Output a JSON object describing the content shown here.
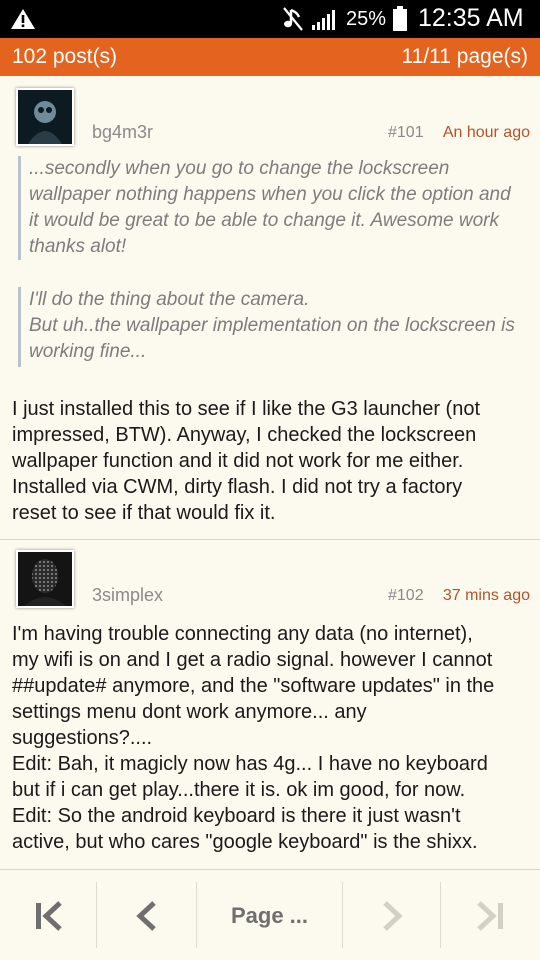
{
  "status_bar": {
    "battery_percent": "25%",
    "time": "12:35 AM",
    "icons": [
      "warning-icon",
      "mute-icon",
      "signal-icon",
      "battery-icon"
    ]
  },
  "header": {
    "posts_count": "102 post(s)",
    "page_info": "11/11 page(s)"
  },
  "posts": [
    {
      "username": "bg4m3r",
      "number": "#101",
      "time": "An hour ago",
      "quotes": [
        [
          "...secondly when you go to change the lockscreen",
          "wallpaper nothing happens when you click the option and",
          "it would be great to be able to change it. Awesome work",
          "thanks alot!"
        ],
        [
          "I'll do the thing about the camera.",
          "But uh..the wallpaper implementation on the lockscreen is",
          "working fine..."
        ]
      ],
      "body": [
        "I just installed this to see if I like the G3 launcher (not",
        "impressed, BTW). Anyway, I checked the lockscreen",
        "wallpaper function and it did not work for me either.",
        "Installed via CWM, dirty flash. I did not try a factory",
        "reset to see if that would fix it."
      ]
    },
    {
      "username": "3simplex",
      "number": "#102",
      "time": "37 mins ago",
      "body": [
        "I'm having trouble connecting any data (no internet),",
        "my wifi is on and I get a radio signal. however I cannot",
        "##update# anymore, and the \"software updates\" in the",
        "settings menu dont work anymore... any",
        "suggestions?....",
        "Edit: Bah, it magicly now has 4g... I have no keyboard",
        "but if i can get play...there it is. ok im good, for now.",
        "Edit: So the android keyboard is there it just wasn't",
        "active, but who cares \"google keyboard\" is the shixx."
      ]
    }
  ],
  "nav": {
    "page_label": "Page ...",
    "icons": [
      "first-page-icon",
      "prev-page-icon",
      "next-page-icon",
      "last-page-icon"
    ]
  },
  "colors": {
    "accent": "#e4641f",
    "background": "#fcf9ee",
    "time_text": "#b3552a"
  }
}
